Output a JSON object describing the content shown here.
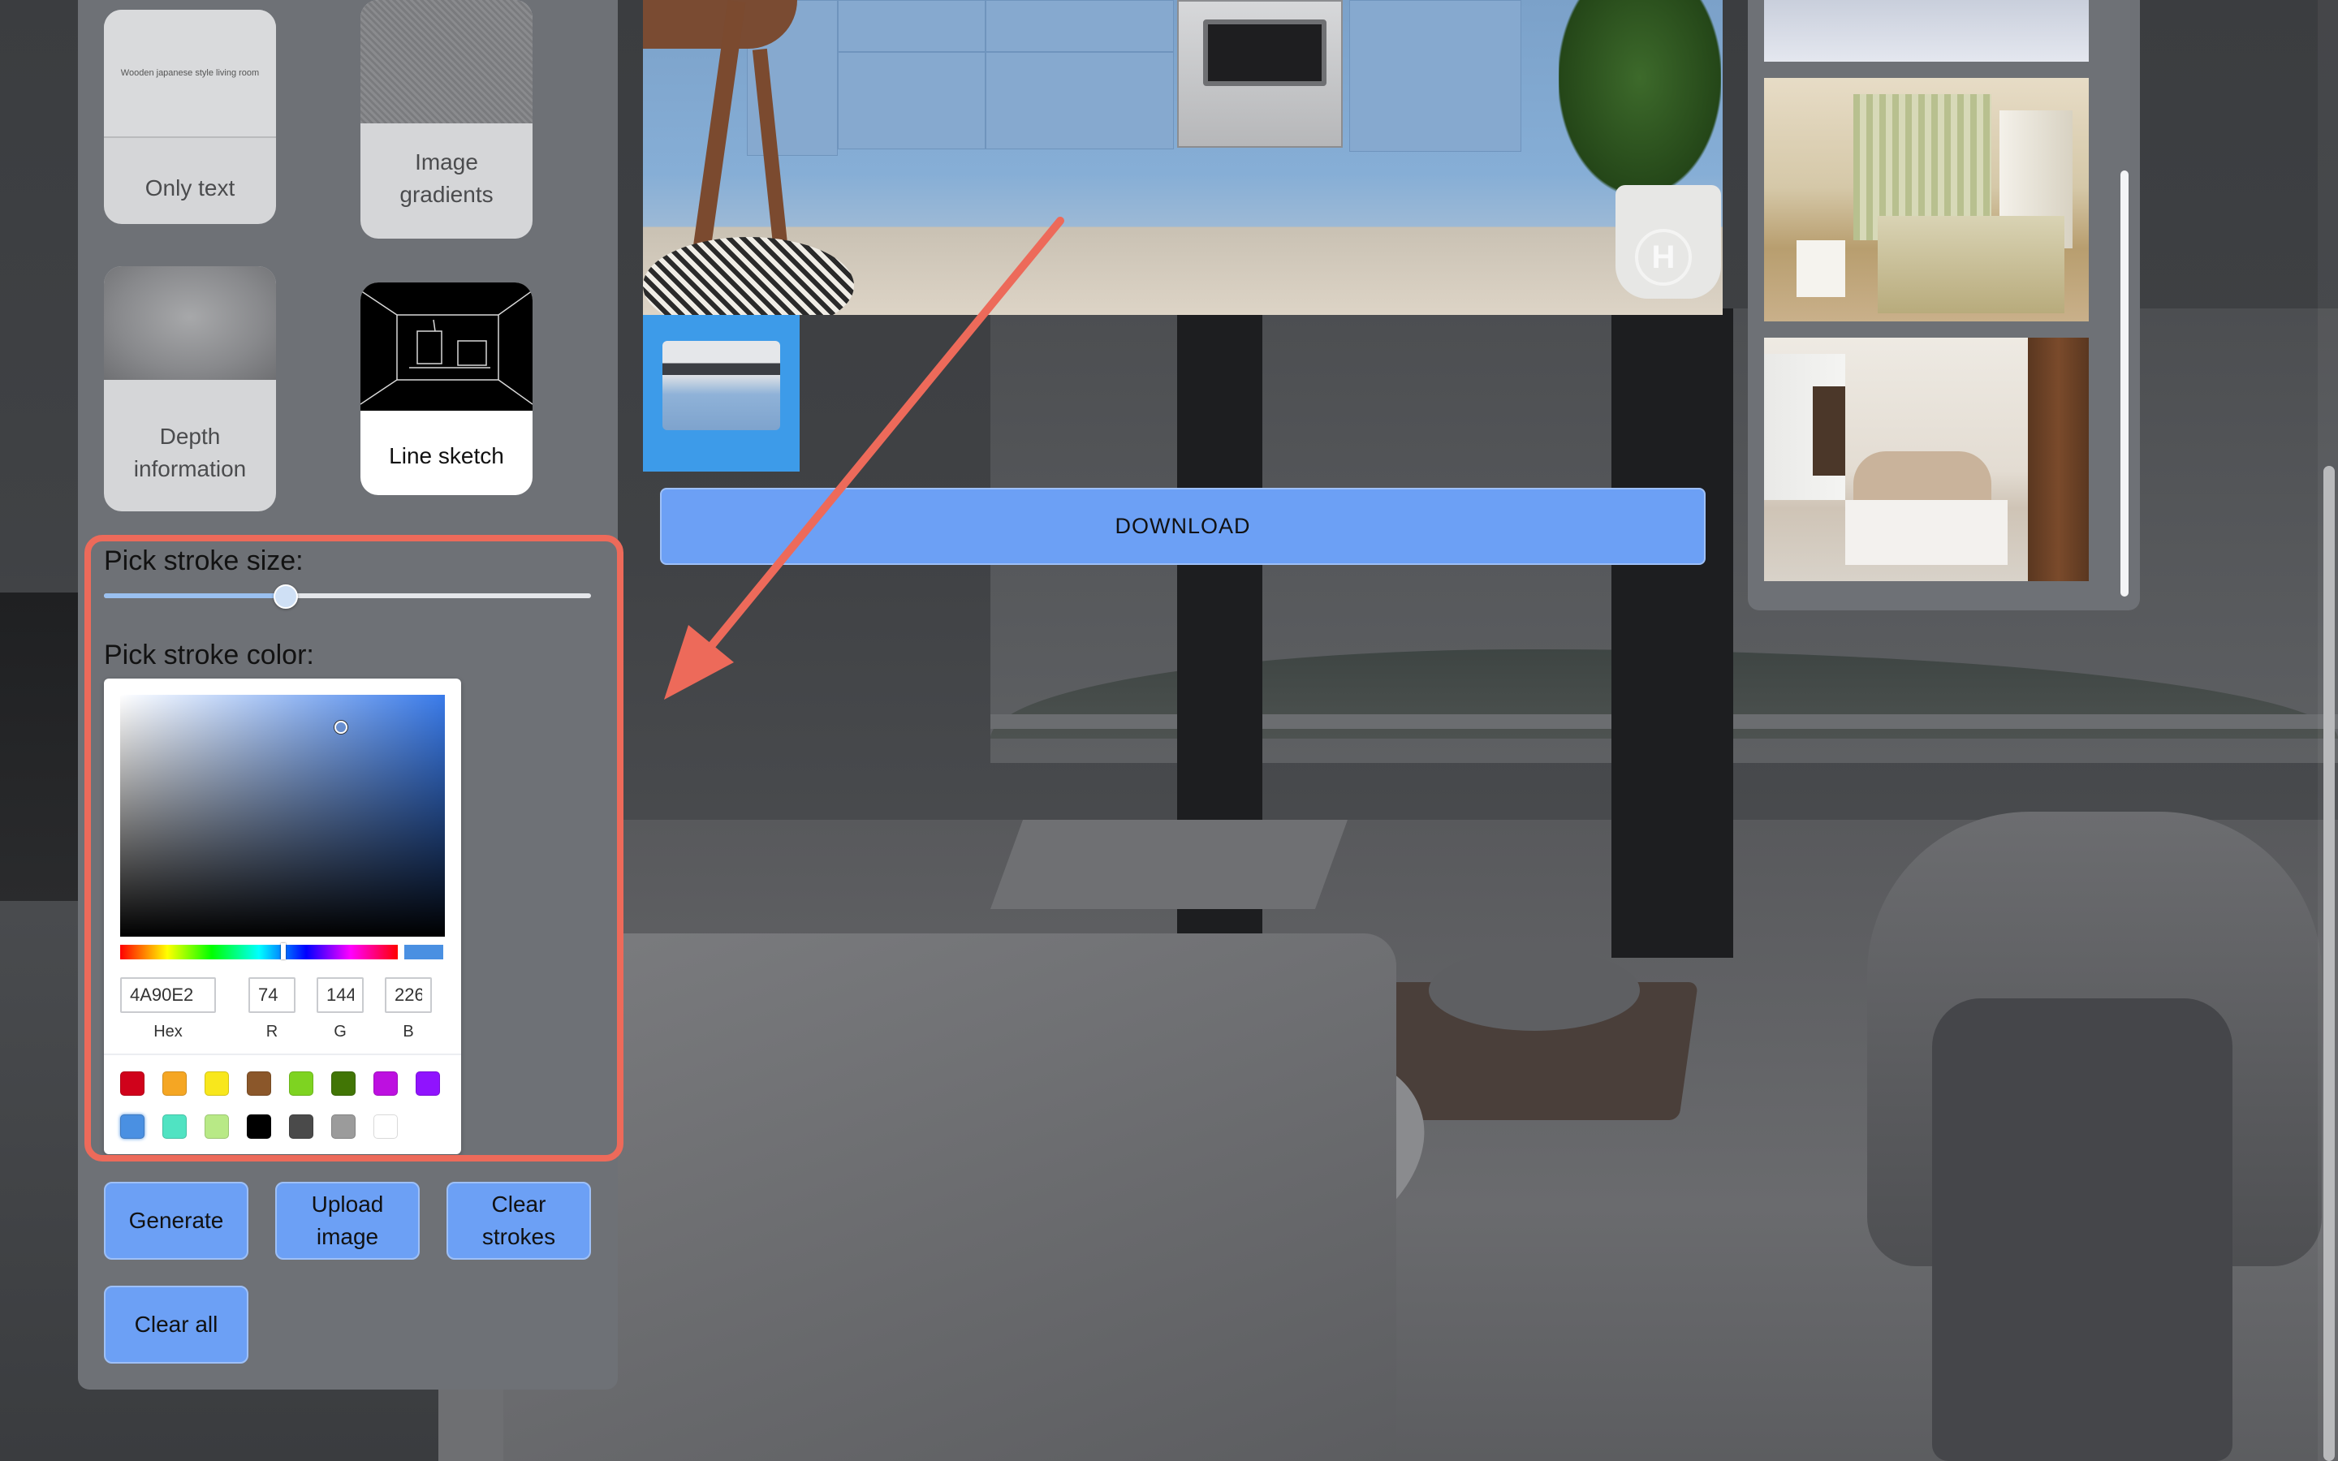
{
  "modes": [
    {
      "key": "only_text",
      "label": "Only text",
      "thumb_text": "Wooden japanese style living room"
    },
    {
      "key": "image_gradients",
      "label": "Image gradients"
    },
    {
      "key": "depth_information",
      "label": "Depth information"
    },
    {
      "key": "line_sketch",
      "label": "Line sketch"
    }
  ],
  "stroke": {
    "size_label": "Pick stroke size:",
    "size_value_fraction": 0.37,
    "color_label": "Pick stroke color:"
  },
  "picker": {
    "hex": "4A90E2",
    "r": "74",
    "g": "144",
    "b": "226",
    "hex_label": "Hex",
    "r_label": "R",
    "g_label": "G",
    "b_label": "B",
    "selected_color": "#4a90e2",
    "swatches_row1": [
      "#d0021b",
      "#f5a623",
      "#f8e71c",
      "#8b572a",
      "#7ed321",
      "#417505",
      "#bd10e0",
      "#9013fe"
    ],
    "swatches_row2": [
      "#4a90e2",
      "#50e3c2",
      "#b8e986",
      "#000000",
      "#4a4a4a",
      "#9b9b9b",
      "#ffffff"
    ]
  },
  "buttons": {
    "generate": "Generate",
    "upload": "Upload image",
    "clear_strokes": "Clear strokes",
    "clear_all": "Clear all",
    "download": "DOWNLOAD"
  },
  "watermark": "H",
  "colors": {
    "accent_button": "#6ca0f5",
    "highlight": "#ed6a5a",
    "selected_thumb": "#3d9be9"
  }
}
